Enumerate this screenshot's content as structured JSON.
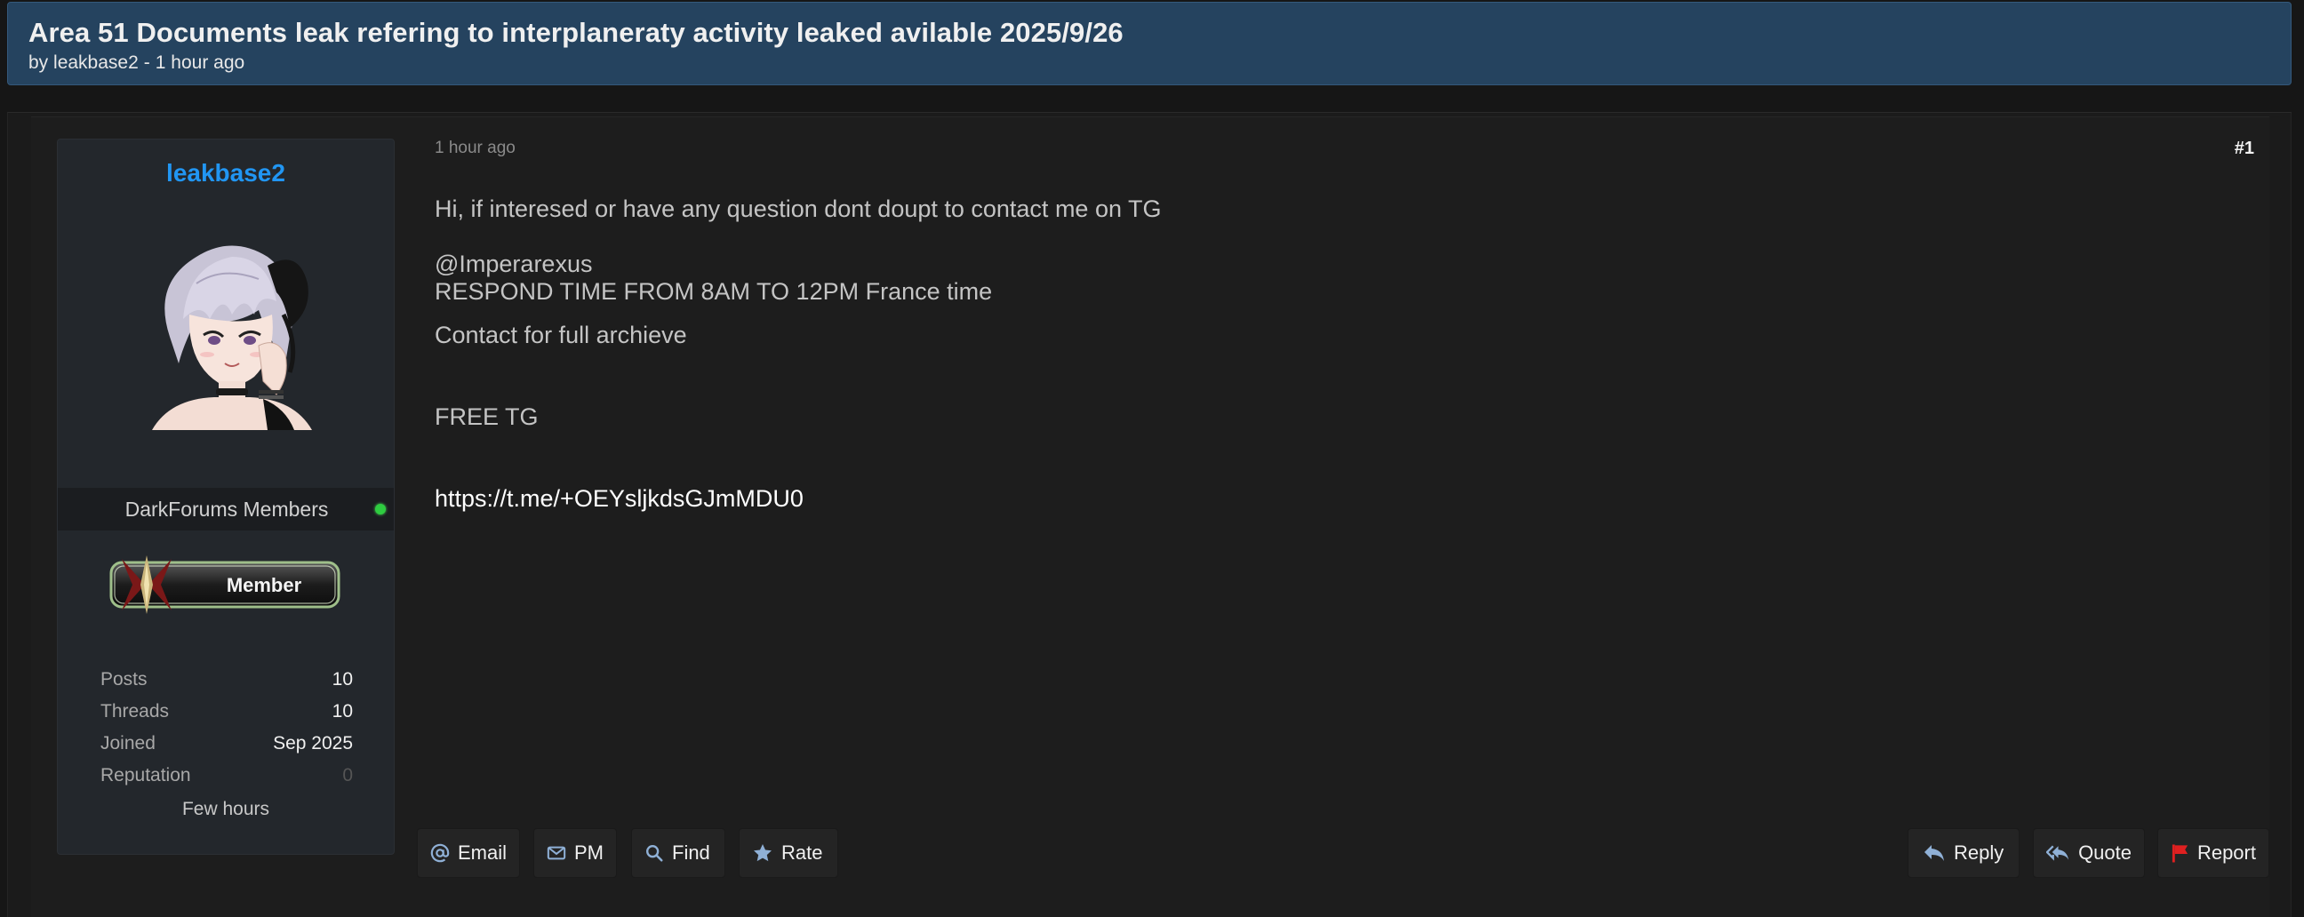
{
  "thread": {
    "title": "Area 51 Documents leak refering to interplaneraty activity leaked avilable 2025/9/26",
    "by_prefix": "by",
    "author": "leakbase2",
    "separator": "-",
    "time": "1 hour ago"
  },
  "author": {
    "username": "leakbase2",
    "group": "DarkForums Members",
    "online_status_color": "#2ecc40",
    "rank_badge_text": "Member",
    "stats": [
      {
        "label": "Posts",
        "value": "10"
      },
      {
        "label": "Threads",
        "value": "10"
      },
      {
        "label": "Joined",
        "value": "Sep 2025"
      },
      {
        "label": "Reputation",
        "value": "0"
      }
    ],
    "last_seen": "Few hours"
  },
  "post": {
    "time": "1 hour ago",
    "number": "#1",
    "lines": [
      "Hi, if interesed or have any question dont doupt to contact me on TG",
      "@Imperarexus",
      "RESPOND TIME FROM 8AM TO 12PM France time",
      "Contact for full archieve",
      "FREE TG",
      "https://t.me/+OEYsljkdsGJmMDU0"
    ]
  },
  "actions": {
    "email": {
      "label": "Email",
      "icon": "at-icon"
    },
    "pm": {
      "label": "PM",
      "icon": "envelope-icon"
    },
    "find": {
      "label": "Find",
      "icon": "search-icon"
    },
    "rate": {
      "label": "Rate",
      "icon": "star-icon"
    },
    "reply": {
      "label": "Reply",
      "icon": "reply-icon"
    },
    "quote": {
      "label": "Quote",
      "icon": "quote-icon"
    },
    "report": {
      "label": "Report",
      "icon": "flag-icon"
    }
  },
  "colors": {
    "header_bg": "#25435f",
    "username": "#2196f3",
    "accent_icon": "#8fb0d6",
    "report_flag": "#e02020"
  }
}
